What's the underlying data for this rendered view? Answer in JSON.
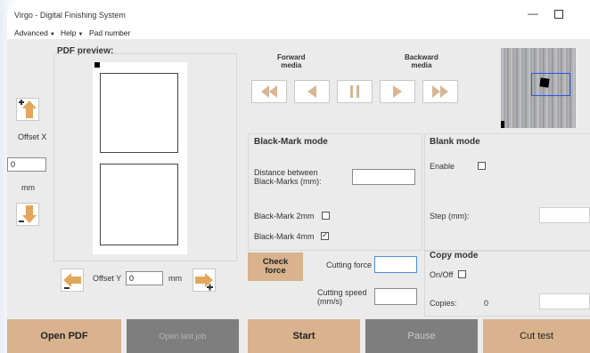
{
  "app": {
    "title": "Virgo - Digital Finishing System"
  },
  "menu": [
    {
      "label": "Advanced",
      "has_caret": true
    },
    {
      "label": "Help",
      "has_caret": true
    },
    {
      "label": "Pad number",
      "has_caret": false
    }
  ],
  "preview": {
    "label": "PDF preview:"
  },
  "offset_x": {
    "label": "Offset X",
    "value": "0",
    "unit": "mm"
  },
  "offset_y": {
    "label": "Offset Y",
    "value": "0",
    "unit": "mm"
  },
  "media": {
    "forward_label": "Forward\nmedia",
    "backward_label": "Backward\nmedia"
  },
  "black_mark": {
    "title": "Black-Mark mode",
    "distance_label": "Distance between\nBlack-Marks (mm):",
    "distance_value": "",
    "mark_2mm_label": "Black-Mark 2mm",
    "mark_2mm_checked": false,
    "mark_4mm_label": "Black-Mark 4mm",
    "mark_4mm_checked": true
  },
  "blank": {
    "title": "Blank mode",
    "enable_label": "Enable",
    "enable_checked": false,
    "step_label": "Step (mm):",
    "step_value": ""
  },
  "cutting": {
    "check_force_label": "Check\nforce",
    "force_label": "Cutting force",
    "force_value": "",
    "speed_label": "Cutting speed\n(mm/s)",
    "speed_value": ""
  },
  "copy": {
    "title": "Copy mode",
    "onoff_label": "On/Off",
    "onoff_checked": false,
    "copies_label": "Copies:",
    "copies_value": "0"
  },
  "buttons": {
    "open_pdf": "Open PDF",
    "open_last_job": "Open last job",
    "start": "Start",
    "pause": "Pause",
    "cut_test": "Cut test"
  },
  "colors": {
    "accent_tan": "#d8b38e",
    "disabled_gray": "#7e7e7e",
    "arrow_orange": "#e2a75c",
    "arrow_tan": "#d9b594"
  }
}
